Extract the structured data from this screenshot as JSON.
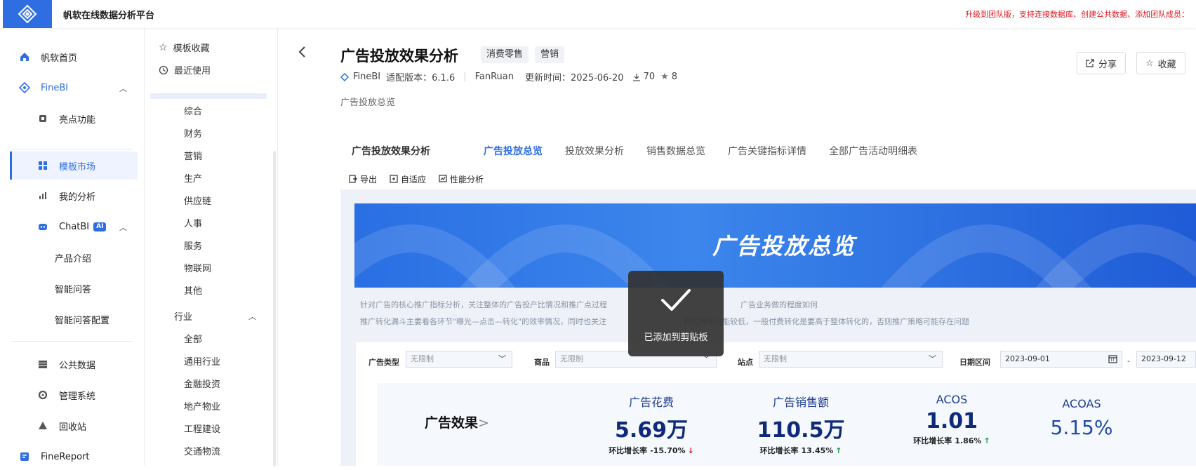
{
  "app": {
    "title": "帆软在线数据分析平台",
    "upgrade_notice": "升级到团队版，支持连接数据库、创建公共数据、添加团队成员："
  },
  "leftnav": {
    "items": [
      {
        "label": "帆软首页",
        "icon": "home-icon"
      },
      {
        "label": "FineBI",
        "icon": "finebi-logo-icon"
      },
      {
        "label": "亮点功能",
        "icon": "highlight-icon"
      },
      {
        "label": "模板市场",
        "icon": "grid-icon"
      },
      {
        "label": "我的分析",
        "icon": "chart-icon"
      },
      {
        "label": "ChatBI",
        "icon": "chatbot-icon",
        "badge": "AI"
      },
      {
        "label": "产品介绍"
      },
      {
        "label": "智能问答"
      },
      {
        "label": "智能问答配置"
      },
      {
        "label": "公共数据",
        "icon": "database-icon"
      },
      {
        "label": "管理系统",
        "icon": "settings-icon"
      },
      {
        "label": "回收站",
        "icon": "recycle-icon"
      },
      {
        "label": "FineReport",
        "icon": "finereport-icon"
      }
    ]
  },
  "categories": {
    "favorites": "模板收藏",
    "recent": "最近使用",
    "business": [
      "综合",
      "财务",
      "营销",
      "生产",
      "供应链",
      "人事",
      "服务",
      "物联网",
      "其他"
    ],
    "industry_header": "行业",
    "industry": [
      "全部",
      "通用行业",
      "金融投资",
      "地产物业",
      "工程建设",
      "交通物流"
    ]
  },
  "detail": {
    "title": "广告投放效果分析",
    "tags": [
      "消费零售",
      "营销"
    ],
    "product": "FineBI",
    "version": "适配版本：6.1.6",
    "author": "FanRuan",
    "updated": "更新时间：2025-06-20",
    "downloads": "70",
    "stars": "8",
    "subtitle": "广告投放总览",
    "share_label": "分享",
    "collect_label": "收藏"
  },
  "tabs": [
    "广告投放效果分析",
    "广告投放总览",
    "投放效果分析",
    "销售数据总览",
    "广告关键指标详情",
    "全部广告活动明细表"
  ],
  "selected_tab": 1,
  "toolbar": {
    "export": "导出",
    "fit": "自适应",
    "perf": "性能分析"
  },
  "dashboard": {
    "banner_title": "广告投放总览",
    "desc1": "针对广告的核心推广指标分析，关注整体的广告投产比情况和推广点过程",
    "desc1_tail": "广告业务做的程度如何",
    "desc2": "推广转化漏斗主要看各环节\"曝光—点击—转化\"的效率情况，同时也关注",
    "desc2_tail": "期的转化可能较低，一般付费转化是要高于整体转化的，否则推广策略可能存在问题",
    "filters": {
      "ad_type_label": "广告类型",
      "ad_type_value": "无限制",
      "product_label": "商品",
      "product_value": "无限制",
      "site_label": "站点",
      "site_value": "无限制",
      "date_label": "日期区间",
      "date_start": "2023-09-01",
      "date_sep": "-",
      "date_end": "2023-09-12"
    },
    "section_title": "广告效果",
    "section_arrow": ">",
    "kpis": [
      {
        "label": "广告花费",
        "value": "5.69万",
        "change_label": "环比增长率",
        "change": "-15.70%",
        "trend": "down"
      },
      {
        "label": "广告销售额",
        "value": "110.5万",
        "change_label": "环比增长率",
        "change": "13.45%",
        "trend": "up"
      },
      {
        "label": "ACOS",
        "value": "1.01",
        "change_label": "环比增长率",
        "change": "1.86%",
        "trend": "up"
      },
      {
        "label": "ACOAS",
        "value": "5.15%"
      }
    ]
  },
  "toast": {
    "text": "已添加到剪贴板",
    "icon": "check-icon"
  },
  "colors": {
    "accent": "#2f6ee0",
    "notice": "#e0141e",
    "up": "#1a9a3a",
    "down": "#e0141e"
  }
}
